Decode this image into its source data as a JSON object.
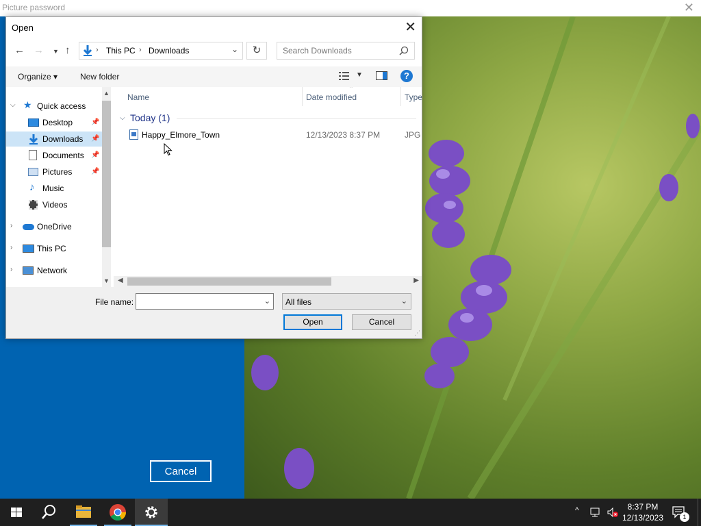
{
  "background_window": {
    "title": "Picture password",
    "cancel_label": "Cancel"
  },
  "dialog": {
    "title": "Open",
    "address": {
      "crumbs": [
        "This PC",
        "Downloads"
      ]
    },
    "search": {
      "placeholder": "Search Downloads"
    },
    "toolbar": {
      "organize_label": "Organize",
      "new_folder_label": "New folder",
      "help_label": "?"
    },
    "nav": {
      "quick_access": "Quick access",
      "items": [
        "Desktop",
        "Downloads",
        "Documents",
        "Pictures",
        "Music",
        "Videos"
      ],
      "onedrive": "OneDrive",
      "this_pc": "This PC",
      "network": "Network"
    },
    "columns": {
      "name": "Name",
      "date_modified": "Date modified",
      "type": "Type"
    },
    "group": {
      "label": "Today (1)"
    },
    "files": [
      {
        "name": "Happy_Elmore_Town",
        "date": "12/13/2023 8:37 PM",
        "type": "JPG F"
      }
    ],
    "file_name_label": "File name:",
    "file_name_value": "",
    "file_type_value": "All files",
    "open_label": "Open",
    "cancel_label": "Cancel",
    "accent_color": "#0078d7",
    "selection_color": "#cce4f7"
  },
  "taskbar": {
    "time": "8:37 PM",
    "date": "12/13/2023",
    "notification_count": "1",
    "background_color": "#1f1f1f"
  }
}
